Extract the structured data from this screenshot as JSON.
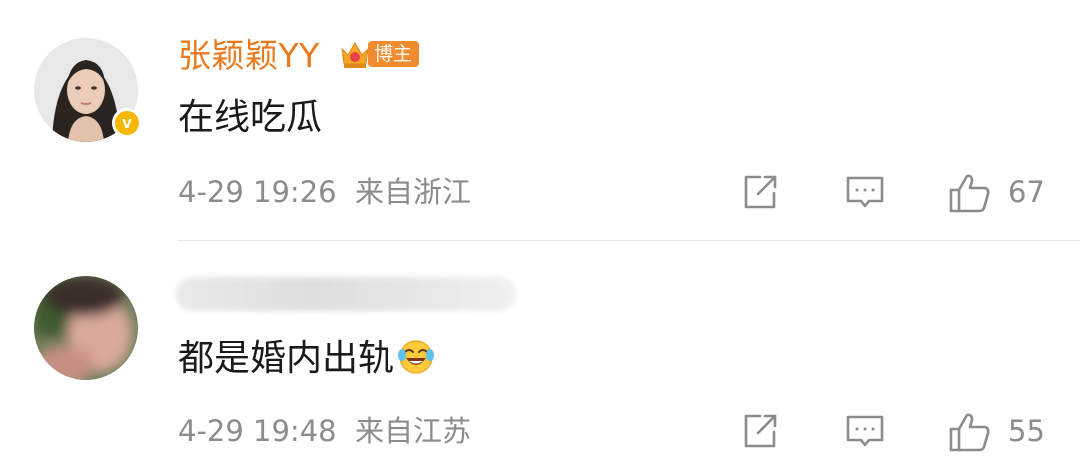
{
  "comments": [
    {
      "username": "张颖颖YY",
      "badge_label": "博主",
      "verified_mark": "v",
      "text": "在线吃瓜",
      "meta": "4-29 19:26  来自浙江",
      "like_count": "67",
      "icons": [
        "share-icon",
        "reply-icon",
        "like-icon"
      ]
    },
    {
      "username": "",
      "text": "都是婚内出轨",
      "emoji": "laughing-crying-emoji",
      "meta": "4-29 19:48  来自江苏",
      "like_count": "55",
      "icons": [
        "share-icon",
        "reply-icon",
        "like-icon"
      ]
    }
  ],
  "colors": {
    "username": "#eb7a1c",
    "badge": "#f28a2e",
    "verified": "#f5b800",
    "meta": "#8c8c8c",
    "text": "#1a1a1a"
  }
}
